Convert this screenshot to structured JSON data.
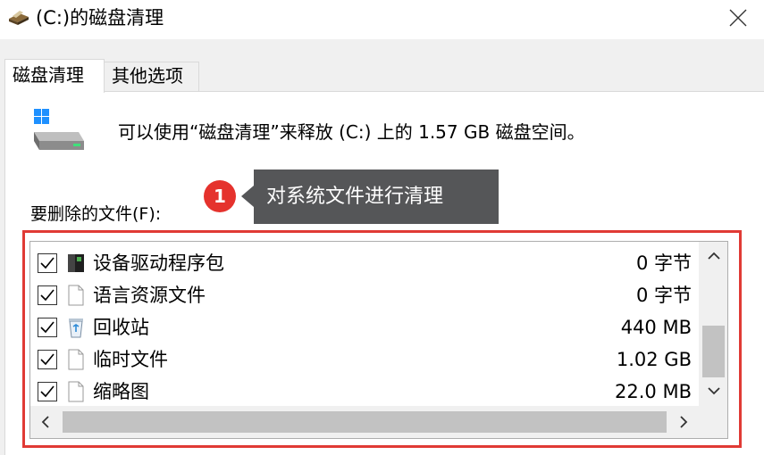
{
  "window": {
    "title": "(C:)的磁盘清理",
    "close_icon": "close-icon"
  },
  "tabs": [
    {
      "label": "磁盘清理",
      "active": true
    },
    {
      "label": "其他选项",
      "active": false
    }
  ],
  "summary": {
    "text": "可以使用“磁盘清理”来释放 (C:) 上的 1.57 GB 磁盘空间。",
    "icon": "drive-icon"
  },
  "files_label": "要删除的文件(F):",
  "annotation": {
    "badge": "1",
    "tooltip": "对系统文件进行清理",
    "highlight_color": "#e03a35"
  },
  "file_list": [
    {
      "name": "设备驱动程序包",
      "size": "0 字节",
      "checked": true,
      "icon": "driver-package-icon"
    },
    {
      "name": "语言资源文件",
      "size": "0 字节",
      "checked": true,
      "icon": "file-icon"
    },
    {
      "name": "回收站",
      "size": "440 MB",
      "checked": true,
      "icon": "recycle-bin-icon"
    },
    {
      "name": "临时文件",
      "size": "1.02 GB",
      "checked": true,
      "icon": "file-icon"
    },
    {
      "name": "缩略图",
      "size": "22.0 MB",
      "checked": true,
      "icon": "file-icon"
    }
  ],
  "colors": {
    "dialog_bg": "#f0f0f0",
    "tooltip_bg": "#555658",
    "badge_bg": "#e5322d"
  }
}
